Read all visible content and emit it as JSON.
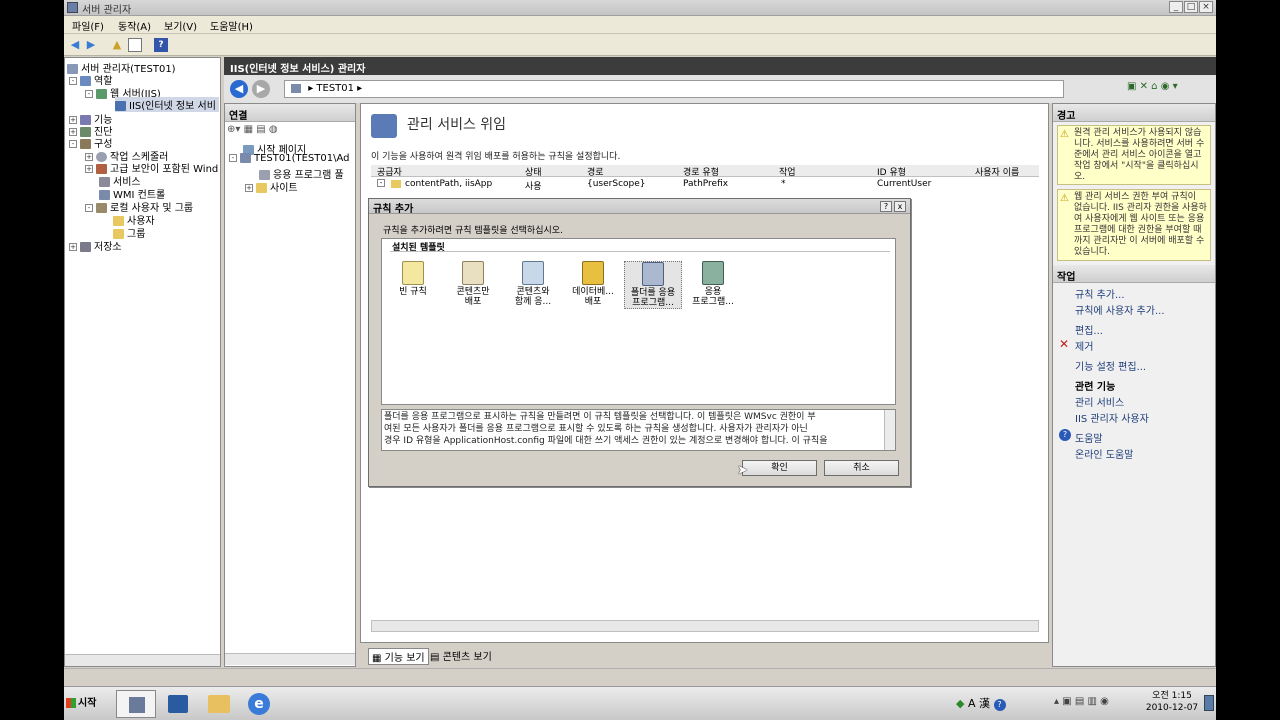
{
  "window": {
    "title": "서버 관리자"
  },
  "menu": [
    "파일(F)",
    "동작(A)",
    "보기(V)",
    "도움말(H)"
  ],
  "tree": {
    "root": "서버 관리자(TEST01)",
    "roles": "역할",
    "web_server": "웹 서버(IIS)",
    "iis": "IIS(인터넷 정보 서비",
    "features": "기능",
    "diagnostics": "진단",
    "configuration": "구성",
    "task_scheduler": "작업 스케줄러",
    "firewall": "고급 보안이 포함된 Wind",
    "services": "서비스",
    "wmi": "WMI 컨트롤",
    "local_users": "로컬 사용자 및 그룹",
    "users": "사용자",
    "groups": "그룹",
    "storage": "저장소"
  },
  "iis_header": "IIS(인터넷 정보 서비스) 관리자",
  "address": {
    "path": "TEST01"
  },
  "connections": {
    "title": "연결",
    "start_page": "시작 페이지",
    "server": "TEST01(TEST01\\Ad",
    "app_pools": "응용 프로그램 풀",
    "sites": "사이트"
  },
  "feature": {
    "title": "관리 서비스 위임",
    "description": "이 기능을 사용하여 원격 위임 배포를 허용하는 규칙을 설정합니다.",
    "columns": [
      "공급자",
      "상태",
      "경로",
      "경로 유형",
      "작업",
      "ID 유형",
      "사용자 이름"
    ],
    "rows": [
      [
        "contentPath, iisApp",
        "사용",
        "{userScope}",
        "PathPrefix",
        "*",
        "CurrentUser",
        ""
      ]
    ]
  },
  "view_tabs": {
    "features": "기능 보기",
    "content": "콘텐츠 보기"
  },
  "dialog": {
    "title": "규칙 추가",
    "help_glyph": "?",
    "close_glyph": "x",
    "instruction": "규칙을 추가하려면 규칙 템플릿을 선택하십시오.",
    "group_label": "설치된 템플릿",
    "templates": [
      {
        "line1": "빈 규칙",
        "line2": ""
      },
      {
        "line1": "콘텐츠만",
        "line2": "배포"
      },
      {
        "line1": "콘텐츠와",
        "line2": "함께 응..."
      },
      {
        "line1": "데이터베...",
        "line2": "배포"
      },
      {
        "line1": "폴더를 응용",
        "line2": "프로그램..."
      },
      {
        "line1": "응용",
        "line2": "프로그램..."
      }
    ],
    "description_lines": [
      "폴더를 응용 프로그램으로 표시하는 규칙을 만들려면 이 규칙 템플릿을 선택합니다. 이 템플릿은 WMSvc 권한이 부",
      "여된 모든 사용자가 폴더를 응용 프로그램으로 표시할 수 있도록 하는 규칙을 생성합니다. 사용자가 관리자가 아닌",
      "경우 ID 유형을 ApplicationHost.config 파일에 대한 쓰기 액세스 권한이 있는 계정으로 변경해야 합니다. 이 규칙을"
    ],
    "ok": "확인",
    "cancel": "취소"
  },
  "alerts": {
    "title": "경고",
    "alert1": "원격 관리 서비스가 사용되지 않습니다. 서비스를 사용하려면 서버 수준에서 관리 서비스 아이콘을 열고 작업 창에서 \"시작\"을 클릭하십시오.",
    "alert2": "웹 관리 서비스 권한 부여 규칙이 없습니다. IIS 관리자 권한을 사용하여 사용자에게 웹 사이트 또는 응용 프로그램에 대한 권한을 부여할 때까지 관리자만 이 서버에 배포할 수 있습니다."
  },
  "actions": {
    "title": "작업",
    "add_rule": "규칙 추가...",
    "add_user_to_rule": "규칙에 사용자 추가...",
    "edit": "편집...",
    "remove": "제거",
    "edit_feature_settings": "기능 설정 편집...",
    "related_features": "관련 기능",
    "management_service": "관리 서비스",
    "iis_manager_users": "IIS 관리자 사용자",
    "help": "도움말",
    "online_help": "온라인 도움말"
  },
  "taskbar": {
    "start": "시작",
    "ime_a": "A",
    "ime_han": "漢",
    "time": "오전 1:15",
    "date": "2010-12-07"
  },
  "colors": {
    "iis_header": "#3c3c3c",
    "link": "#1f3d7a",
    "alert_bg": "#ffffc8",
    "selected": "#d0d8e8"
  }
}
